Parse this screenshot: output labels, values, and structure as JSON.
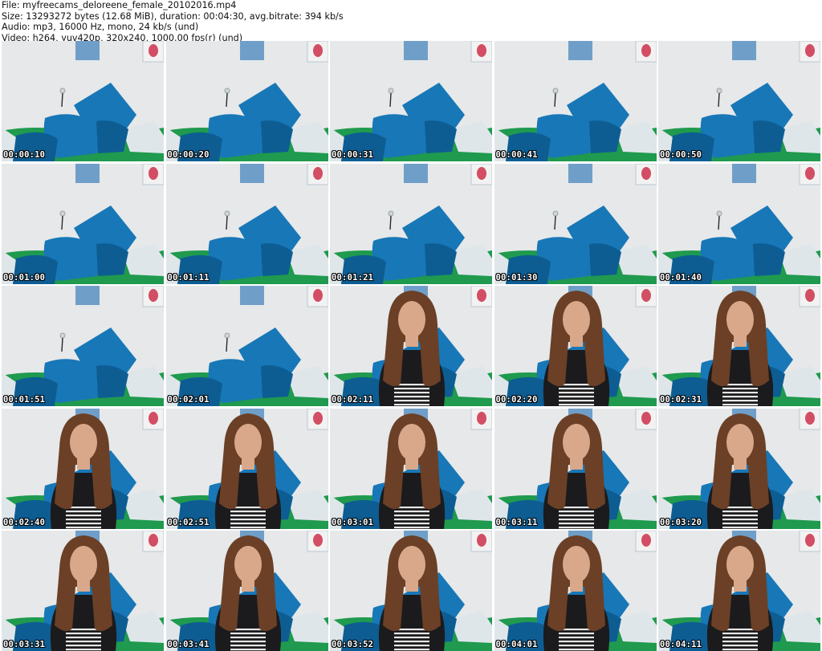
{
  "header": {
    "file_line": "File: myfreecams_deloreene_female_20102016.mp4",
    "size_line": "Size: 13293272 bytes (12.68 MiB), duration: 00:04:30, avg.bitrate: 394 kb/s",
    "audio_line": "Audio: mp3, 16000 Hz, mono, 24 kb/s (und)",
    "video_line": "Video: h264, yuv420p, 320x240, 1000.00 fps(r) (und)"
  },
  "colors": {
    "wall": "#e6e8e9",
    "pillow_blue": "#1877b7",
    "pillow_dark": "#0d5d93",
    "cushion_green": "#1f9a4e",
    "cushion_white": "#dfe6ea",
    "poster_pink": "#d24e64",
    "hair": "#6b4027",
    "skin": "#d9a88a",
    "shirt": "#1b1b1d"
  },
  "thumbnails": [
    {
      "timestamp": "00:00:10",
      "person": false
    },
    {
      "timestamp": "00:00:20",
      "person": false
    },
    {
      "timestamp": "00:00:31",
      "person": false
    },
    {
      "timestamp": "00:00:41",
      "person": false
    },
    {
      "timestamp": "00:00:50",
      "person": false
    },
    {
      "timestamp": "00:01:00",
      "person": false
    },
    {
      "timestamp": "00:01:11",
      "person": false
    },
    {
      "timestamp": "00:01:21",
      "person": false
    },
    {
      "timestamp": "00:01:30",
      "person": false
    },
    {
      "timestamp": "00:01:40",
      "person": false
    },
    {
      "timestamp": "00:01:51",
      "person": false
    },
    {
      "timestamp": "00:02:01",
      "person": false
    },
    {
      "timestamp": "00:02:11",
      "person": true
    },
    {
      "timestamp": "00:02:20",
      "person": true
    },
    {
      "timestamp": "00:02:31",
      "person": true
    },
    {
      "timestamp": "00:02:40",
      "person": true
    },
    {
      "timestamp": "00:02:51",
      "person": true
    },
    {
      "timestamp": "00:03:01",
      "person": true
    },
    {
      "timestamp": "00:03:11",
      "person": true
    },
    {
      "timestamp": "00:03:20",
      "person": true
    },
    {
      "timestamp": "00:03:31",
      "person": true
    },
    {
      "timestamp": "00:03:41",
      "person": true
    },
    {
      "timestamp": "00:03:52",
      "person": true
    },
    {
      "timestamp": "00:04:01",
      "person": true
    },
    {
      "timestamp": "00:04:11",
      "person": true
    }
  ]
}
